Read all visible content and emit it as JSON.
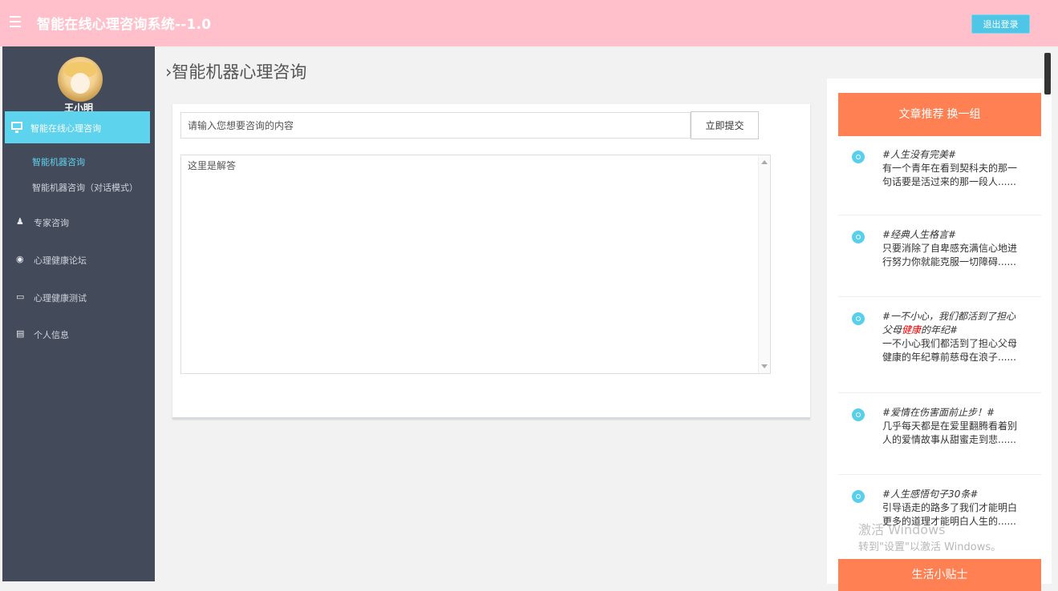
{
  "header": {
    "title": "智能在线心理咨询系统--1.0",
    "logout_label": "退出登录"
  },
  "sidebar": {
    "username": "王小明",
    "active_item": "智能在线心理咨询",
    "sub_items": [
      "智能机器咨询",
      "智能机器咨询（对话模式）"
    ],
    "items": [
      {
        "label": "专家咨询",
        "icon": "user-icon"
      },
      {
        "label": "心理健康论坛",
        "icon": "forum-icon"
      },
      {
        "label": "心理健康测试",
        "icon": "book-icon"
      },
      {
        "label": "个人信息",
        "icon": "chart-icon"
      }
    ]
  },
  "main": {
    "page_title": "›智能机器心理咨询",
    "input_placeholder": "请输入您想要咨询的内容",
    "submit_label": "立即提交",
    "answer_placeholder": "这里是解答"
  },
  "recommend": {
    "header_label": "文章推荐",
    "swap_label": "换一组",
    "articles": [
      {
        "title": "#人生没有完美#",
        "excerpt": "有一个青年在看到契科夫的那一句话要是活过来的那一段人......"
      },
      {
        "title": "#经典人生格言#",
        "excerpt": "只要消除了自卑感充满信心地进行努力你就能克服一切障碍......"
      },
      {
        "title_pre": "#一不小心，我们都活到了担心父母",
        "title_red": "健康",
        "title_post": "的年纪#",
        "excerpt": "一不小心我们都活到了担心父母健康的年纪尊前慈母在浪子......"
      },
      {
        "title": "#爱情在伤害面前止步！#",
        "excerpt": "几乎每天都是在爱里翻腾看着别人的爱情故事从甜蜜走到悲......"
      },
      {
        "title": "#人生感悟句子30条#",
        "excerpt": "引导语走的路多了我们才能明白更多的道理才能明白人生的......"
      }
    ],
    "life_header": "生活小贴士"
  },
  "watermark": {
    "line1": "激活 Windows",
    "line2": "转到\"设置\"以激活 Windows。"
  }
}
